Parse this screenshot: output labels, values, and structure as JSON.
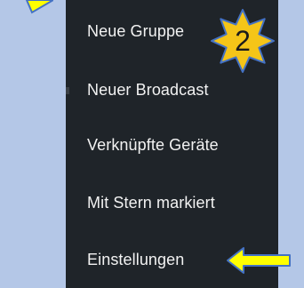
{
  "context_menu": {
    "items": [
      {
        "label": "Neue Gruppe"
      },
      {
        "label": "Neuer Broadcast"
      },
      {
        "label": "Verknüpfte Geräte"
      },
      {
        "label": "Mit Stern markiert"
      },
      {
        "label": "Einstellungen"
      }
    ]
  },
  "annotation": {
    "step_number": "2",
    "badge_color": "#f5c518",
    "arrow_color": "#ffff00",
    "arrow_outline_color": "#4472c4"
  },
  "colors": {
    "menu_background": "#1f2429",
    "menu_text": "#f2f2f2",
    "page_background": "#b4c7e7"
  }
}
